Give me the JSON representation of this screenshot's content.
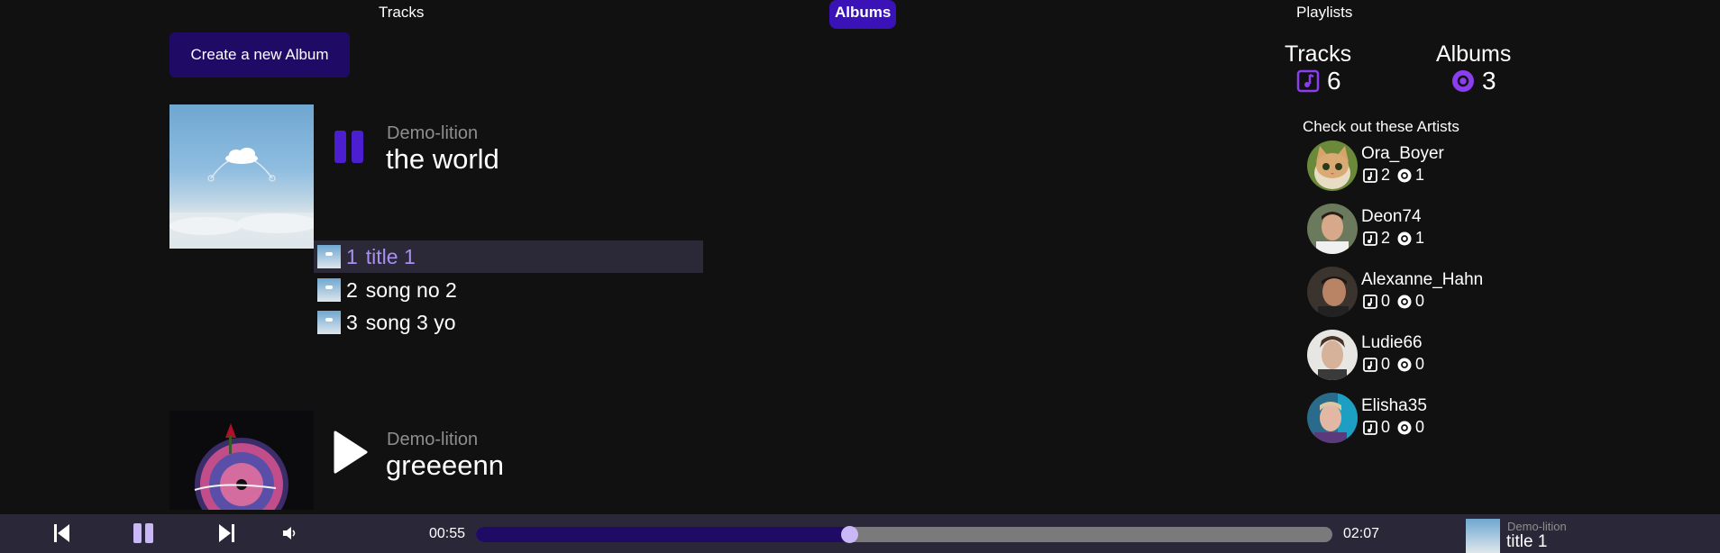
{
  "nav": {
    "tracks": "Tracks",
    "albums": "Albums",
    "playlists": "Playlists",
    "active": "Albums"
  },
  "create_album_label": "Create a new Album",
  "albums": [
    {
      "artist": "Demo-lition",
      "title": "the world",
      "state": "playing",
      "tracks": [
        {
          "num": "1",
          "name": "title 1",
          "active": true
        },
        {
          "num": "2",
          "name": "song no 2",
          "active": false
        },
        {
          "num": "3",
          "name": "song 3 yo",
          "active": false
        }
      ]
    },
    {
      "artist": "Demo-lition",
      "title": "greeeenn",
      "state": "paused"
    }
  ],
  "stats": {
    "tracks_label": "Tracks",
    "tracks_value": "6",
    "albums_label": "Albums",
    "albums_value": "3"
  },
  "artists_heading": "Check out these Artists",
  "artists": [
    {
      "name": "Ora_Boyer",
      "tracks": "2",
      "albums": "1"
    },
    {
      "name": "Deon74",
      "tracks": "2",
      "albums": "1"
    },
    {
      "name": "Alexanne_Hahn",
      "tracks": "0",
      "albums": "0"
    },
    {
      "name": "Ludie66",
      "tracks": "0",
      "albums": "0"
    },
    {
      "name": "Elisha35",
      "tracks": "0",
      "albums": "0"
    }
  ],
  "player": {
    "current_time": "00:55",
    "total_time": "02:07",
    "progress": 0.436,
    "now_artist": "Demo-lition",
    "now_title": "title 1"
  },
  "colors": {
    "accent": "#3a12b8",
    "accent_dark": "#1f0a66",
    "accent_light": "#a98ff0",
    "background": "#111111",
    "player_bg": "#2a2838"
  },
  "icons": {
    "track_icon": "music-note-icon",
    "album_icon": "disc-icon",
    "prev": "skip-previous-icon",
    "pause": "pause-icon",
    "next": "skip-next-icon",
    "volume": "volume-icon",
    "play": "play-icon"
  }
}
